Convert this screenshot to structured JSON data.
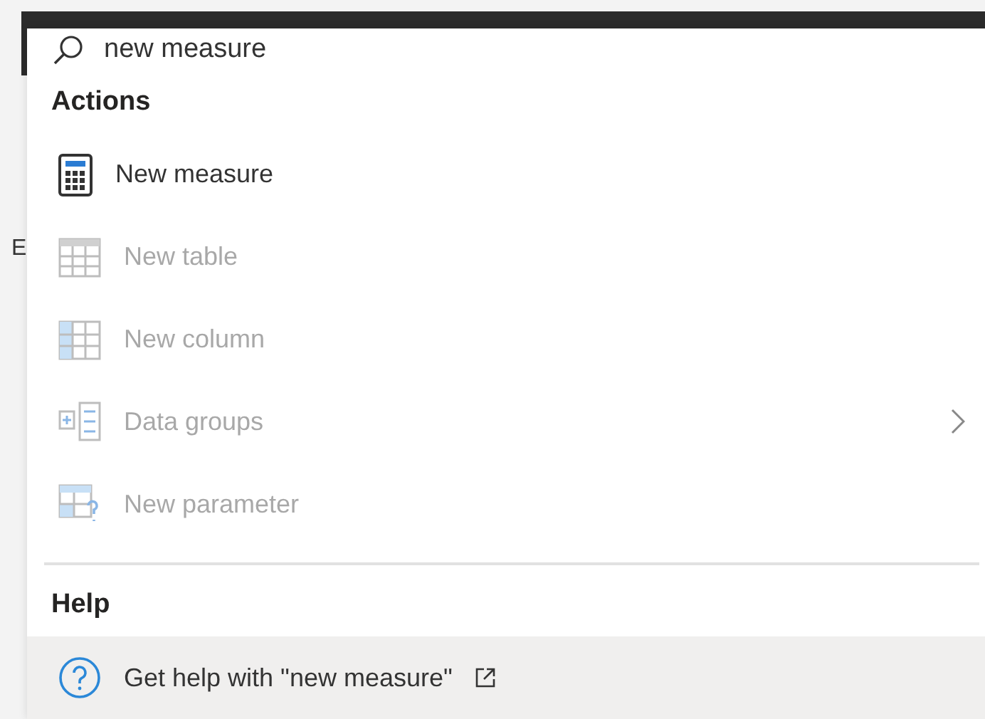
{
  "background_text": "E",
  "search": {
    "value": "new measure"
  },
  "sections": [
    {
      "title": "Actions",
      "items": [
        {
          "kind": "calculator",
          "label": "New measure",
          "disabled": false,
          "submenu": false,
          "selected": false
        },
        {
          "kind": "table",
          "label": "New table",
          "disabled": true,
          "submenu": false,
          "selected": false
        },
        {
          "kind": "column",
          "label": "New column",
          "disabled": true,
          "submenu": false,
          "selected": false
        },
        {
          "kind": "groups",
          "label": "Data groups",
          "disabled": true,
          "submenu": true,
          "selected": false
        },
        {
          "kind": "parameter",
          "label": "New parameter",
          "disabled": true,
          "submenu": false,
          "selected": false
        }
      ]
    },
    {
      "title": "Help",
      "items": [
        {
          "kind": "help",
          "label": "Get help with \"new measure\"",
          "disabled": false,
          "submenu": false,
          "selected": true,
          "external": true
        }
      ]
    }
  ]
}
